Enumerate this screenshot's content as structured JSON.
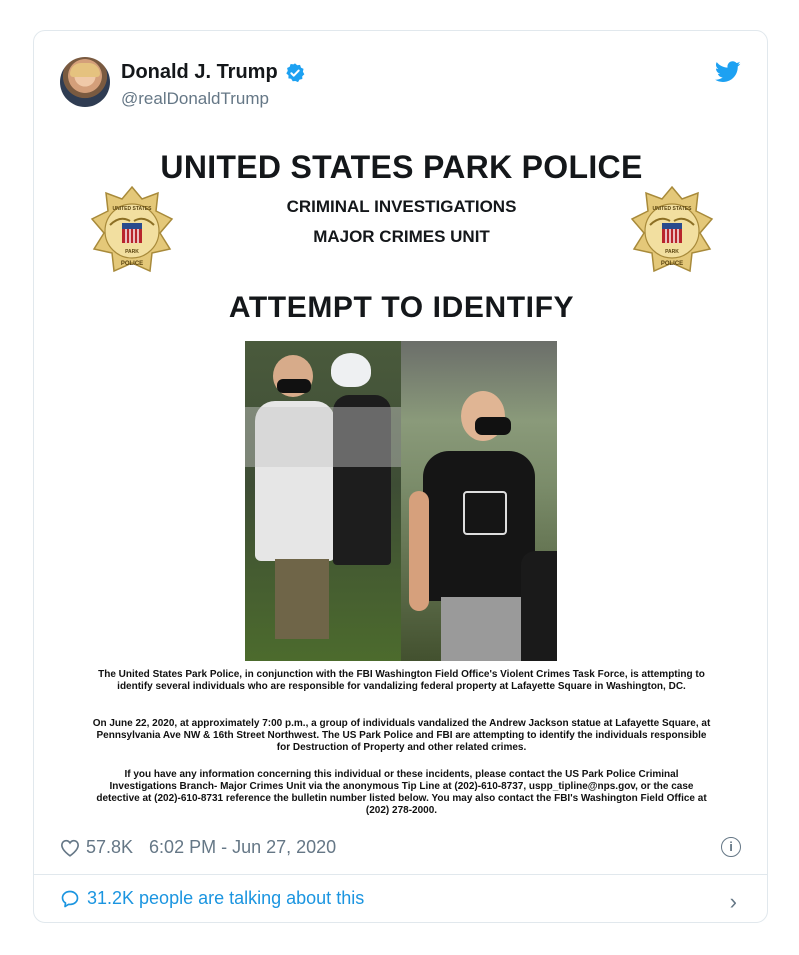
{
  "tweet": {
    "author_name": "Donald J. Trump",
    "handle": "@realDonaldTrump",
    "likes": "57.8K",
    "timestamp": "6:02 PM - Jun 27, 2020",
    "talking": "31.2K people are talking about this",
    "accent_color": "#1b95e0",
    "icons": [
      "avatar",
      "verified-badge-icon",
      "twitter-bird-icon",
      "heart-icon",
      "info-icon",
      "speech-bubble-icon",
      "chevron-right-icon"
    ]
  },
  "poster": {
    "title": "UNITED STATES PARK POLICE",
    "sub1": "CRIMINAL INVESTIGATIONS",
    "sub2": "MAJOR CRIMES UNIT",
    "badge_top": "UNITED STATES",
    "badge_park": "PARK",
    "badge_bottom": "POLICE",
    "heading": "ATTEMPT TO IDENTIFY",
    "para1": "The United States Park Police, in conjunction with the FBI Washington Field Office's Violent Crimes Task Force, is attempting to identify several individuals who are responsible for vandalizing federal property at Lafayette Square in Washington, DC.",
    "para2": "On June 22, 2020, at approximately 7:00 p.m., a group of individuals vandalized the Andrew Jackson statue at Lafayette Square, at Pennsylvania Ave NW & 16th Street Northwest.  The US Park Police and FBI are attempting to identify the individuals responsible for Destruction of Property and other related crimes.",
    "para3": "If you have any information concerning this individual or these incidents, please contact the US Park Police Criminal Investigations Branch- Major Crimes Unit via the anonymous Tip Line at (202)-610-8737, uspp_tipline@nps.gov, or the case detective at (202)-610-8731 reference the bulletin number listed below. You may also contact the FBI's Washington Field Office at (202) 278-2000."
  }
}
